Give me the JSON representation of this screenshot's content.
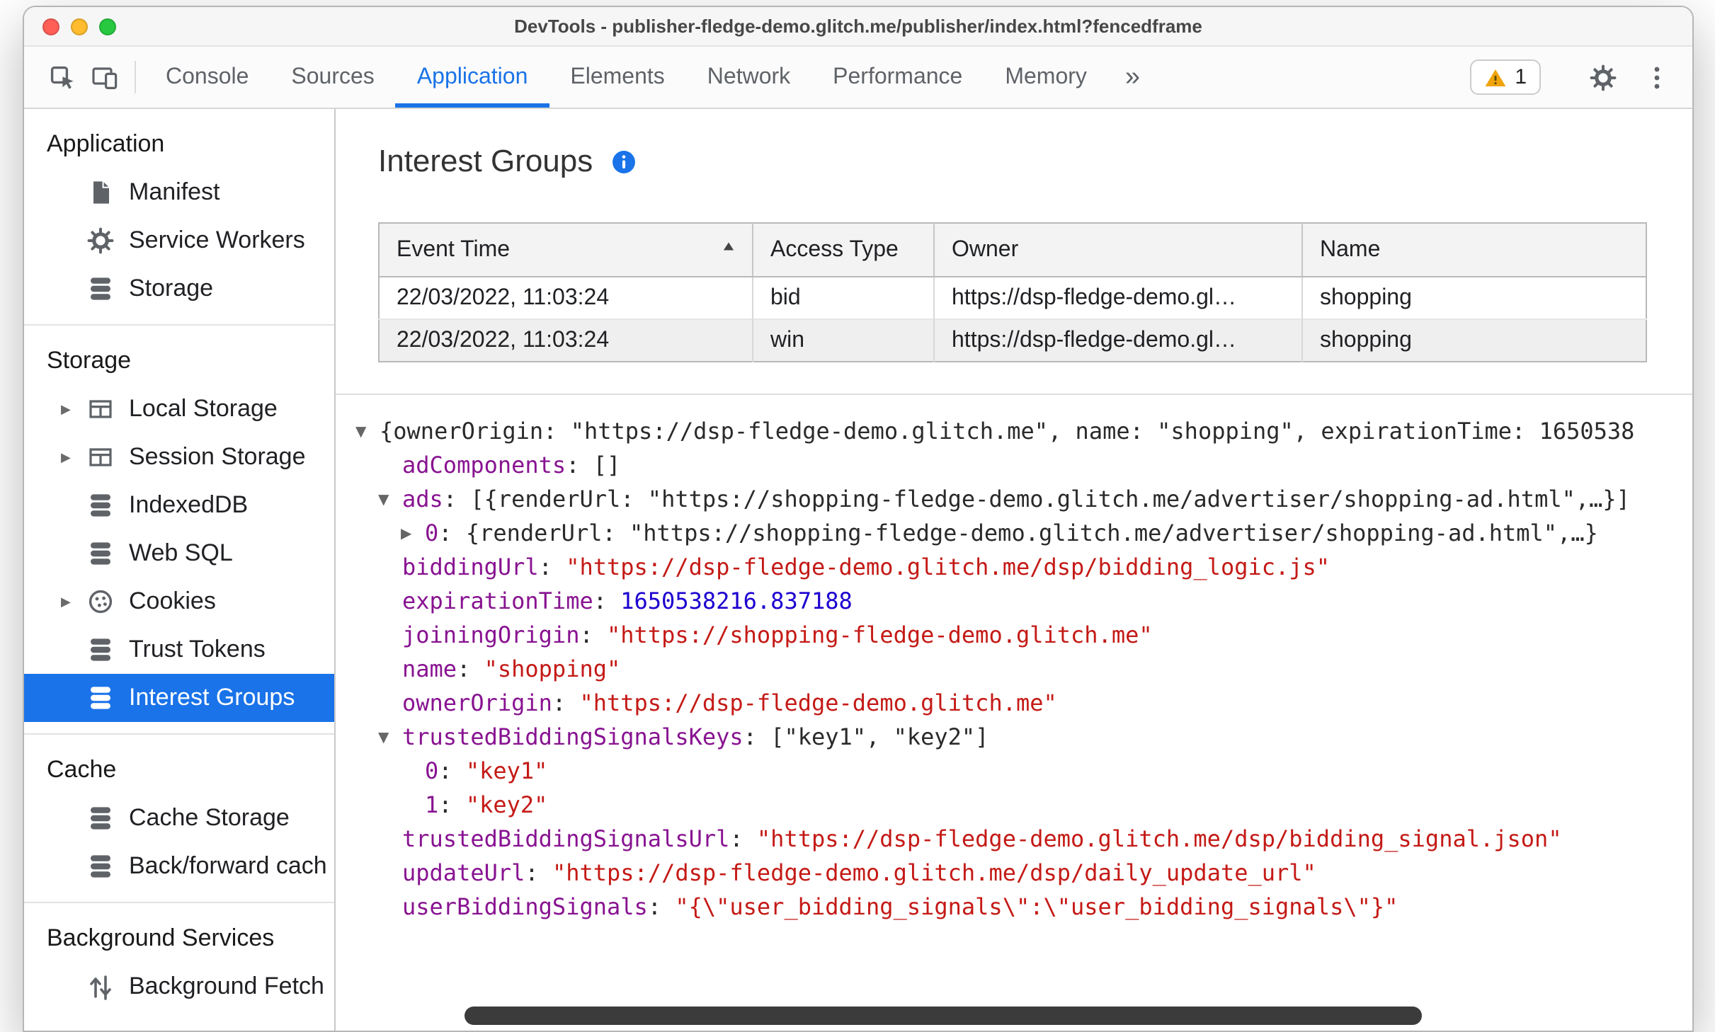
{
  "colors": {
    "accent_blue": "#1a73e8",
    "selection_bg": "#1a73e8",
    "selection_text": "#ffffff",
    "syntax_key": "#881391",
    "syntax_string": "#c41a16",
    "syntax_number": "#1c00cf",
    "warning_yellow": "#f0a40a"
  },
  "window": {
    "title": "DevTools - publisher-fledge-demo.glitch.me/publisher/index.html?fencedframe"
  },
  "toolbar": {
    "left_icons": [
      "inspect-icon",
      "device-toolbar-icon"
    ],
    "tabs": [
      {
        "label": "Console",
        "active": false
      },
      {
        "label": "Sources",
        "active": false
      },
      {
        "label": "Application",
        "active": true
      },
      {
        "label": "Elements",
        "active": false
      },
      {
        "label": "Network",
        "active": false
      },
      {
        "label": "Performance",
        "active": false
      },
      {
        "label": "Memory",
        "active": false
      }
    ],
    "overflow_chevron": "»",
    "issues_badge": {
      "icon": "warning-icon",
      "count": "1"
    },
    "right_icons": [
      "gear-icon",
      "more-menu-icon"
    ]
  },
  "sidebar": {
    "sections": [
      {
        "title": "Application",
        "items": [
          {
            "label": "Manifest",
            "icon": "manifest-file-icon"
          },
          {
            "label": "Service Workers",
            "icon": "gear-icon"
          },
          {
            "label": "Storage",
            "icon": "database-icon"
          }
        ]
      },
      {
        "title": "Storage",
        "items": [
          {
            "label": "Local Storage",
            "icon": "table-icon",
            "expander": "▶"
          },
          {
            "label": "Session Storage",
            "icon": "table-icon",
            "expander": "▶"
          },
          {
            "label": "IndexedDB",
            "icon": "database-icon"
          },
          {
            "label": "Web SQL",
            "icon": "database-icon"
          },
          {
            "label": "Cookies",
            "icon": "cookie-icon",
            "expander": "▶"
          },
          {
            "label": "Trust Tokens",
            "icon": "database-icon"
          },
          {
            "label": "Interest Groups",
            "icon": "database-icon",
            "selected": true
          }
        ]
      },
      {
        "title": "Cache",
        "items": [
          {
            "label": "Cache Storage",
            "icon": "database-icon"
          },
          {
            "label": "Back/forward cache",
            "icon": "database-icon"
          }
        ]
      },
      {
        "title": "Background Services",
        "items": [
          {
            "label": "Background Fetch",
            "icon": "background-fetch-icon"
          }
        ]
      }
    ]
  },
  "main": {
    "heading": "Interest Groups",
    "info_icon": "info-icon",
    "table": {
      "columns": [
        {
          "label": "Event Time",
          "sort": "asc"
        },
        {
          "label": "Access Type"
        },
        {
          "label": "Owner"
        },
        {
          "label": "Name"
        }
      ],
      "rows": [
        [
          "22/03/2022, 11:03:24",
          "bid",
          "https://dsp-fledge-demo.gl…",
          "shopping"
        ],
        [
          "22/03/2022, 11:03:24",
          "win",
          "https://dsp-fledge-demo.gl…",
          "shopping"
        ]
      ]
    },
    "tree": {
      "lines": [
        {
          "indent": 0,
          "arrow": "▼",
          "tokens": [
            {
              "c": "p",
              "v": "{ownerOrigin: \"https://dsp-fledge-demo.glitch.me\", name: \"shopping\", expirationTime: 1650538"
            }
          ]
        },
        {
          "indent": 1,
          "arrow": null,
          "tokens": [
            {
              "c": "k",
              "v": "adComponents"
            },
            {
              "c": "p",
              "v": ": "
            },
            {
              "c": "p",
              "v": "[]"
            }
          ]
        },
        {
          "indent": 1,
          "arrow": "▼",
          "tokens": [
            {
              "c": "k",
              "v": "ads"
            },
            {
              "c": "p",
              "v": ": "
            },
            {
              "c": "p",
              "v": "[{renderUrl: \"https://shopping-fledge-demo.glitch.me/advertiser/shopping-ad.html\",…}]"
            }
          ]
        },
        {
          "indent": 2,
          "arrow": "▶",
          "tokens": [
            {
              "c": "k",
              "v": "0"
            },
            {
              "c": "p",
              "v": ": "
            },
            {
              "c": "p",
              "v": "{renderUrl: \"https://shopping-fledge-demo.glitch.me/advertiser/shopping-ad.html\",…}"
            }
          ]
        },
        {
          "indent": 1,
          "arrow": null,
          "tokens": [
            {
              "c": "k",
              "v": "biddingUrl"
            },
            {
              "c": "p",
              "v": ": "
            },
            {
              "c": "s",
              "v": "\"https://dsp-fledge-demo.glitch.me/dsp/bidding_logic.js\""
            }
          ]
        },
        {
          "indent": 1,
          "arrow": null,
          "tokens": [
            {
              "c": "k",
              "v": "expirationTime"
            },
            {
              "c": "p",
              "v": ": "
            },
            {
              "c": "n",
              "v": "1650538216.837188"
            }
          ]
        },
        {
          "indent": 1,
          "arrow": null,
          "tokens": [
            {
              "c": "k",
              "v": "joiningOrigin"
            },
            {
              "c": "p",
              "v": ": "
            },
            {
              "c": "s",
              "v": "\"https://shopping-fledge-demo.glitch.me\""
            }
          ]
        },
        {
          "indent": 1,
          "arrow": null,
          "tokens": [
            {
              "c": "k",
              "v": "name"
            },
            {
              "c": "p",
              "v": ": "
            },
            {
              "c": "s",
              "v": "\"shopping\""
            }
          ]
        },
        {
          "indent": 1,
          "arrow": null,
          "tokens": [
            {
              "c": "k",
              "v": "ownerOrigin"
            },
            {
              "c": "p",
              "v": ": "
            },
            {
              "c": "s",
              "v": "\"https://dsp-fledge-demo.glitch.me\""
            }
          ]
        },
        {
          "indent": 1,
          "arrow": "▼",
          "tokens": [
            {
              "c": "k",
              "v": "trustedBiddingSignalsKeys"
            },
            {
              "c": "p",
              "v": ": "
            },
            {
              "c": "p",
              "v": "[\"key1\", \"key2\"]"
            }
          ]
        },
        {
          "indent": 2,
          "arrow": null,
          "tokens": [
            {
              "c": "k",
              "v": "0"
            },
            {
              "c": "p",
              "v": ": "
            },
            {
              "c": "s",
              "v": "\"key1\""
            }
          ]
        },
        {
          "indent": 2,
          "arrow": null,
          "tokens": [
            {
              "c": "k",
              "v": "1"
            },
            {
              "c": "p",
              "v": ": "
            },
            {
              "c": "s",
              "v": "\"key2\""
            }
          ]
        },
        {
          "indent": 1,
          "arrow": null,
          "tokens": [
            {
              "c": "k",
              "v": "trustedBiddingSignalsUrl"
            },
            {
              "c": "p",
              "v": ": "
            },
            {
              "c": "s",
              "v": "\"https://dsp-fledge-demo.glitch.me/dsp/bidding_signal.json\""
            }
          ]
        },
        {
          "indent": 1,
          "arrow": null,
          "tokens": [
            {
              "c": "k",
              "v": "updateUrl"
            },
            {
              "c": "p",
              "v": ": "
            },
            {
              "c": "s",
              "v": "\"https://dsp-fledge-demo.glitch.me/dsp/daily_update_url\""
            }
          ]
        },
        {
          "indent": 1,
          "arrow": null,
          "tokens": [
            {
              "c": "k",
              "v": "userBiddingSignals"
            },
            {
              "c": "p",
              "v": ": "
            },
            {
              "c": "s",
              "v": "\"{\\\"user_bidding_signals\\\":\\\"user_bidding_signals\\\"}\""
            }
          ]
        }
      ]
    }
  }
}
